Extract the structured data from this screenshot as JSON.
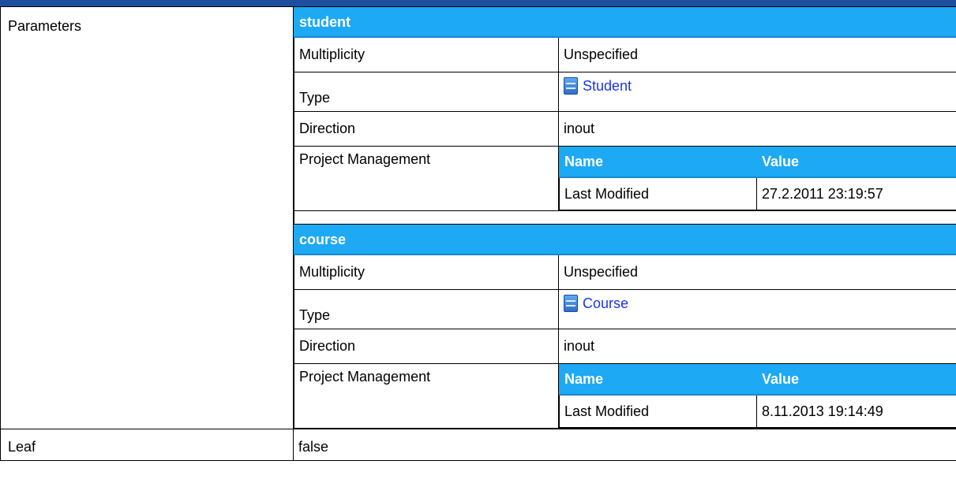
{
  "rows": {
    "parameters_label": "Parameters",
    "leaf_label": "Leaf",
    "leaf_value": "false"
  },
  "parameters": [
    {
      "name": "student",
      "multiplicity_label": "Multiplicity",
      "multiplicity_value": "Unspecified",
      "type_label": "Type",
      "type_value": "Student",
      "type_icon": "class-icon",
      "direction_label": "Direction",
      "direction_value": "inout",
      "pm_label": "Project Management",
      "pm_headers": [
        "Name",
        "Value"
      ],
      "pm_rows": [
        [
          "Last Modified",
          "27.2.2011 23:19:57"
        ]
      ]
    },
    {
      "name": "course",
      "multiplicity_label": "Multiplicity",
      "multiplicity_value": "Unspecified",
      "type_label": "Type",
      "type_value": "Course",
      "type_icon": "class-icon",
      "direction_label": "Direction",
      "direction_value": "inout",
      "pm_label": "Project Management",
      "pm_headers": [
        "Name",
        "Value"
      ],
      "pm_rows": [
        [
          "Last Modified",
          "8.11.2013 19:14:49"
        ]
      ]
    }
  ],
  "colors": {
    "header_bg": "#1ea9f5",
    "top_bar": "#1e4f9f",
    "link": "#1a35e8"
  }
}
